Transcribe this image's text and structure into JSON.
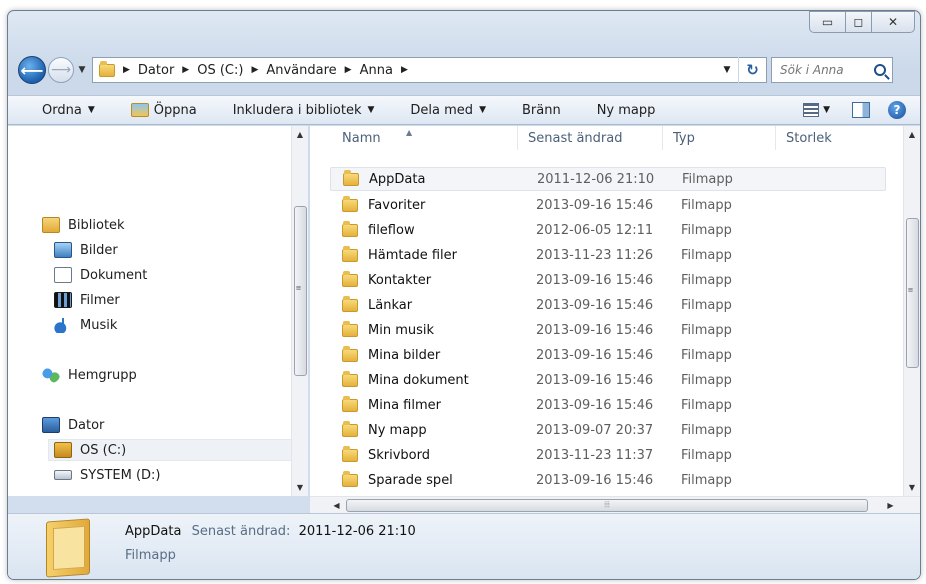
{
  "window": {
    "caption": {
      "minimize": "▭",
      "maximize": "◻",
      "close": "✕"
    }
  },
  "address_bar": {
    "breadcrumbs": [
      "Dator",
      "OS (C:)",
      "Användare",
      "Anna"
    ],
    "search_placeholder": "Sök i Anna"
  },
  "toolbar": {
    "organize": "Ordna",
    "open": "Öppna",
    "include_in_library": "Inkludera i bibliotek",
    "share_with": "Dela med",
    "burn": "Bränn",
    "new_folder": "Ny mapp"
  },
  "nav_pane": {
    "items": [
      {
        "label": "Bibliotek",
        "icon": "library-icon"
      },
      {
        "label": "Bilder",
        "icon": "pictures-icon"
      },
      {
        "label": "Dokument",
        "icon": "documents-icon"
      },
      {
        "label": "Filmer",
        "icon": "videos-icon"
      },
      {
        "label": "Musik",
        "icon": "music-icon"
      },
      {
        "label": "Hemgrupp",
        "icon": "homegroup-icon"
      },
      {
        "label": "Dator",
        "icon": "computer-icon"
      },
      {
        "label": "OS (C:)",
        "icon": "drive-icon",
        "selected": true
      },
      {
        "label": "SYSTEM (D:)",
        "icon": "drive-icon"
      }
    ]
  },
  "file_list": {
    "columns": [
      "Namn",
      "Senast ändrad",
      "Typ",
      "Storlek"
    ],
    "rows": [
      {
        "name": "AppData",
        "modified": "2011-12-06 21:10",
        "type": "Filmapp",
        "selected": true
      },
      {
        "name": "Favoriter",
        "modified": "2013-09-16 15:46",
        "type": "Filmapp"
      },
      {
        "name": "fileflow",
        "modified": "2012-06-05 12:11",
        "type": "Filmapp"
      },
      {
        "name": "Hämtade filer",
        "modified": "2013-11-23 11:26",
        "type": "Filmapp"
      },
      {
        "name": "Kontakter",
        "modified": "2013-09-16 15:46",
        "type": "Filmapp"
      },
      {
        "name": "Länkar",
        "modified": "2013-09-16 15:46",
        "type": "Filmapp"
      },
      {
        "name": "Min musik",
        "modified": "2013-09-16 15:46",
        "type": "Filmapp"
      },
      {
        "name": "Mina bilder",
        "modified": "2013-09-16 15:46",
        "type": "Filmapp"
      },
      {
        "name": "Mina dokument",
        "modified": "2013-09-16 15:46",
        "type": "Filmapp"
      },
      {
        "name": "Mina filmer",
        "modified": "2013-09-16 15:46",
        "type": "Filmapp"
      },
      {
        "name": "Ny mapp",
        "modified": "2013-09-07 20:37",
        "type": "Filmapp"
      },
      {
        "name": "Skrivbord",
        "modified": "2013-11-23 11:37",
        "type": "Filmapp"
      },
      {
        "name": "Sparade spel",
        "modified": "2013-09-16 15:46",
        "type": "Filmapp"
      }
    ]
  },
  "details_pane": {
    "name": "AppData",
    "modified_label": "Senast ändrad:",
    "modified": "2011-12-06 21:10",
    "type": "Filmapp"
  }
}
